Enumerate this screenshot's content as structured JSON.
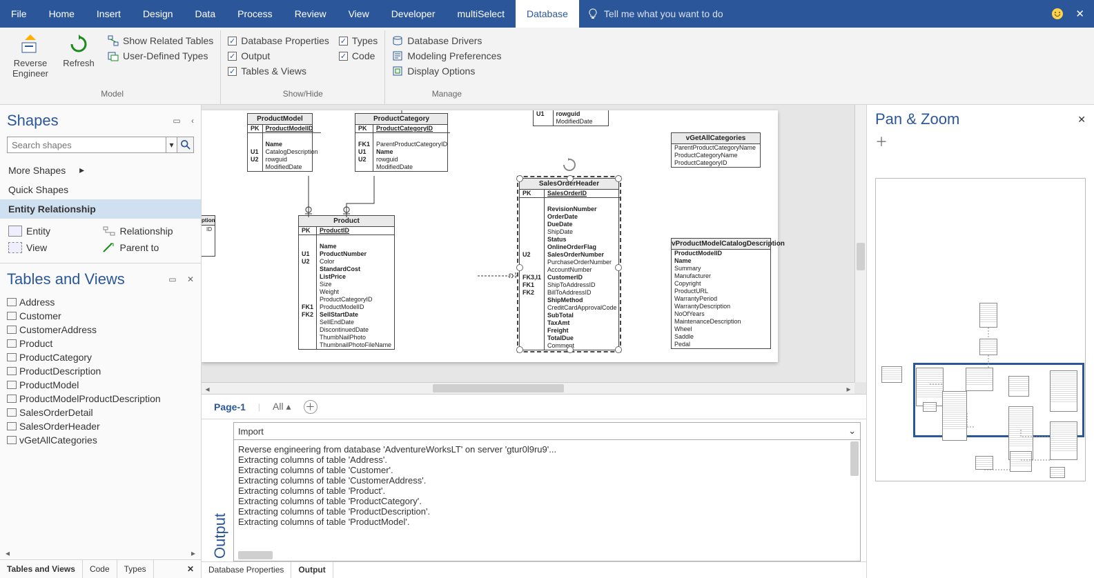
{
  "menubar": {
    "tabs": [
      "File",
      "Home",
      "Insert",
      "Design",
      "Data",
      "Process",
      "Review",
      "View",
      "Developer",
      "multiSelect",
      "Database"
    ],
    "active_index": 10,
    "tellme_placeholder": "Tell me what you want to do"
  },
  "ribbon": {
    "groups": [
      {
        "label": "Model",
        "bigbuttons": [
          {
            "label": "Reverse Engineer",
            "iconcolor": "#2b579a"
          },
          {
            "label": "Refresh",
            "iconcolor": "#1a8a1a"
          }
        ],
        "smallbuttons": [
          {
            "label": "Show Related Tables",
            "checkbox": false
          },
          {
            "label": "User-Defined Types",
            "checkbox": false
          }
        ]
      },
      {
        "label": "Show/Hide",
        "columns": [
          [
            {
              "label": "Database Properties",
              "checked": true
            },
            {
              "label": "Output",
              "checked": true
            },
            {
              "label": "Tables & Views",
              "checked": true
            }
          ],
          [
            {
              "label": "Types",
              "checked": true
            },
            {
              "label": "Code",
              "checked": true
            }
          ]
        ]
      },
      {
        "label": "Manage",
        "items": [
          {
            "label": "Database Drivers"
          },
          {
            "label": "Modeling Preferences"
          },
          {
            "label": "Display Options"
          }
        ]
      }
    ]
  },
  "shapes_panel": {
    "title": "Shapes",
    "search_placeholder": "Search shapes",
    "more": "More Shapes",
    "quick": "Quick Shapes",
    "selected_stencil": "Entity Relationship",
    "stencil_items": [
      "Entity",
      "Relationship",
      "View",
      "Parent to"
    ]
  },
  "tables_panel": {
    "title": "Tables and Views",
    "items": [
      "Address",
      "Customer",
      "CustomerAddress",
      "Product",
      "ProductCategory",
      "ProductDescription",
      "ProductModel",
      "ProductModelProductDescription",
      "SalesOrderDetail",
      "SalesOrderHeader",
      "vGetAllCategories"
    ],
    "tabs": [
      "Tables and Views",
      "Code",
      "Types"
    ]
  },
  "canvas": {
    "entities": {
      "productModel": {
        "title": "ProductModel",
        "pk": "ProductModelID",
        "keys": [
          "",
          "U1",
          "U2",
          ""
        ],
        "rows": [
          "Name",
          "CatalogDescription",
          "rowguid",
          "ModifiedDate"
        ],
        "bold": [
          true,
          false,
          false,
          false
        ]
      },
      "productCategory": {
        "title": "ProductCategory",
        "pk": "ProductCategoryID",
        "keys": [
          "FK1",
          "U1",
          "U2",
          ""
        ],
        "rows": [
          "ParentProductCategoryID",
          "Name",
          "rowguid",
          "ModifiedDate"
        ],
        "bold": [
          false,
          true,
          false,
          false
        ]
      },
      "partialTop": {
        "keys": [
          "U1",
          "",
          ""
        ],
        "rows": [
          "rowguid",
          "ModifiedDate"
        ],
        "bold": [
          true,
          false
        ]
      },
      "vGetAll": {
        "title": "vGetAllCategories",
        "rows": [
          "ParentProductCategoryName",
          "ProductCategoryName",
          "ProductCategoryID"
        ]
      },
      "product": {
        "title": "Product",
        "pk": "ProductID",
        "keys": [
          "",
          "U1",
          "U2",
          "",
          "",
          "",
          "",
          "",
          "FK1",
          "FK2",
          "",
          "",
          "",
          "",
          ""
        ],
        "rows": [
          "Name",
          "ProductNumber",
          "Color",
          "StandardCost",
          "ListPrice",
          "Size",
          "Weight",
          "ProductCategoryID",
          "ProductModelID",
          "SellStartDate",
          "SellEndDate",
          "DiscontinuedDate",
          "ThumbNailPhoto",
          "ThumbnailPhotoFileName"
        ],
        "bold": [
          true,
          true,
          false,
          true,
          true,
          false,
          false,
          false,
          false,
          true,
          false,
          false,
          false,
          false
        ]
      },
      "salesOrderHeader": {
        "title": "SalesOrderHeader",
        "pk": "SalesOrderID",
        "keys": [
          "",
          "",
          "",
          "",
          "",
          "",
          "U2",
          "",
          "",
          "FK3,I1",
          "FK1",
          "FK2",
          "",
          "",
          "",
          "",
          "",
          "",
          ""
        ],
        "rows": [
          "RevisionNumber",
          "OrderDate",
          "DueDate",
          "ShipDate",
          "Status",
          "OnlineOrderFlag",
          "SalesOrderNumber",
          "PurchaseOrderNumber",
          "AccountNumber",
          "CustomerID",
          "ShipToAddressID",
          "BillToAddressID",
          "ShipMethod",
          "CreditCardApprovalCode",
          "SubTotal",
          "TaxAmt",
          "Freight",
          "TotalDue",
          "Comment"
        ],
        "bold": [
          true,
          true,
          true,
          false,
          true,
          true,
          true,
          false,
          false,
          true,
          false,
          false,
          true,
          false,
          true,
          true,
          true,
          true,
          false
        ]
      },
      "vPMCD": {
        "title": "vProductModelCatalogDescription",
        "rows": [
          "ProductModelID",
          "Name",
          "Summary",
          "Manufacturer",
          "Copyright",
          "ProductURL",
          "WarrantyPeriod",
          "WarrantyDescription",
          "NoOfYears",
          "MaintenanceDescription",
          "Wheel",
          "Saddle",
          "Pedal"
        ],
        "bold": [
          true,
          true,
          false,
          false,
          false,
          false,
          false,
          false,
          false,
          false,
          false,
          false,
          false
        ]
      }
    }
  },
  "pagesbar": {
    "page": "Page-1",
    "all": "All"
  },
  "output": {
    "title": "Output",
    "select": "Import",
    "lines": [
      "Reverse engineering from database 'AdventureWorksLT' on server 'gtur0l9ru9'...",
      "Extracting columns of table 'Address'.",
      "Extracting columns of table 'Customer'.",
      "Extracting columns of table 'CustomerAddress'.",
      "Extracting columns of table 'Product'.",
      "Extracting columns of table 'ProductCategory'.",
      "Extracting columns of table 'ProductDescription'.",
      "Extracting columns of table 'ProductModel'."
    ]
  },
  "bottom_tabs": [
    "Database Properties",
    "Output"
  ],
  "panzoom": {
    "title": "Pan & Zoom"
  }
}
